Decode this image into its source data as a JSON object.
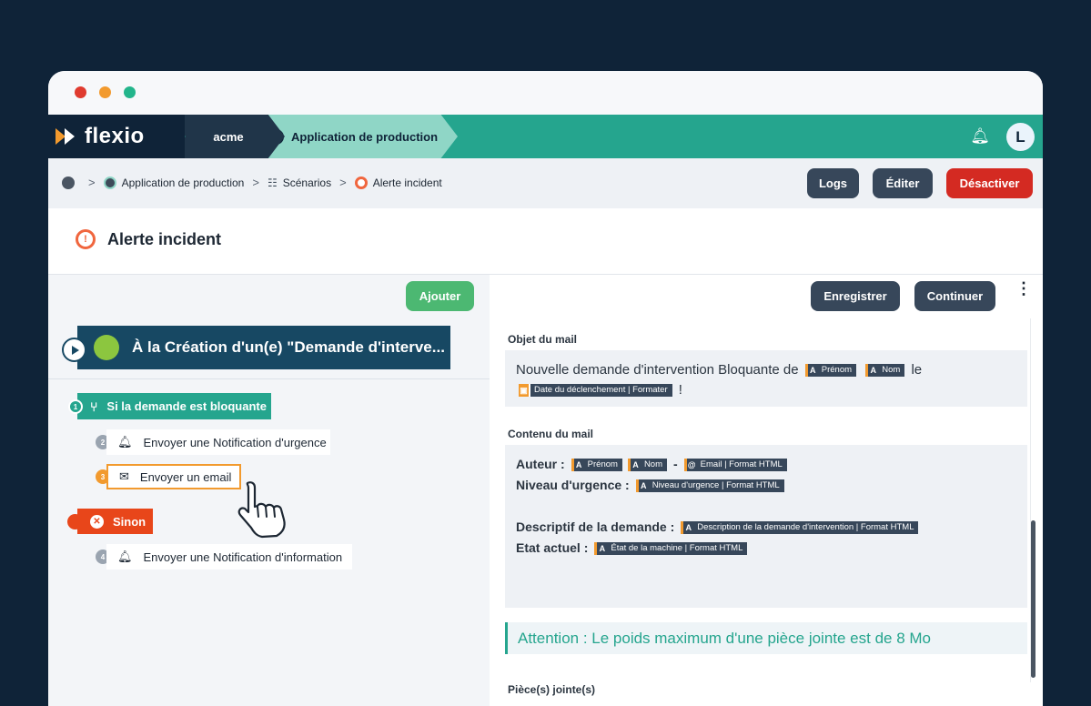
{
  "nav": {
    "brand": "flexio",
    "account": "acme",
    "app": "Application de production",
    "user_initial": "L"
  },
  "breadcrumb": {
    "items": [
      "Application de production",
      "Scénarios",
      "Alerte incident"
    ]
  },
  "actions": {
    "logs": "Logs",
    "edit": "Éditer",
    "deactivate": "Désactiver"
  },
  "page": {
    "title": "Alerte incident"
  },
  "left": {
    "add_label": "Ajouter",
    "trigger": "À la Création d'un(e) \"Demande d'interve...",
    "condition": {
      "num": "1",
      "label": "Si la demande est bloquante"
    },
    "steps": [
      {
        "num": "2",
        "label": "Envoyer une Notification d'urgence"
      },
      {
        "num": "3",
        "label": "Envoyer un email"
      },
      {
        "num": "4",
        "label": "Envoyer une Notification d'information"
      }
    ],
    "else_label": "Sinon"
  },
  "right": {
    "save_label": "Enregistrer",
    "continue_label": "Continuer",
    "subject_label": "Objet du mail",
    "subject": {
      "text1": "Nouvelle demande d'intervention Bloquante de",
      "chip_firstname": "Prénom",
      "chip_lastname": "Nom",
      "text2": "le",
      "chip_date": "Date du déclenchement | Formater",
      "text3": "!"
    },
    "content_label": "Contenu du mail",
    "content": {
      "author_label": "Auteur :",
      "chip_firstname": "Prénom",
      "chip_lastname": "Nom",
      "dash": "-",
      "chip_email": "Email | Format HTML",
      "urgency_label": "Niveau d'urgence :",
      "chip_urgency": "Niveau d'urgence | Format HTML",
      "desc_label": "Descriptif de la demande :",
      "chip_desc": "Description de la demande d'intervention | Format HTML",
      "state_label": "Etat actuel :",
      "chip_state": "État de la machine | Format HTML"
    },
    "notice": "Attention : Le poids maximum d'une pièce jointe est de 8 Mo",
    "attachments_label": "Pièce(s) jointe(s)"
  },
  "colors": {
    "accent": "#25a58e",
    "navy": "#0f2338",
    "danger": "#d42a22",
    "success": "#4cb872",
    "warning": "#f29a2e"
  }
}
